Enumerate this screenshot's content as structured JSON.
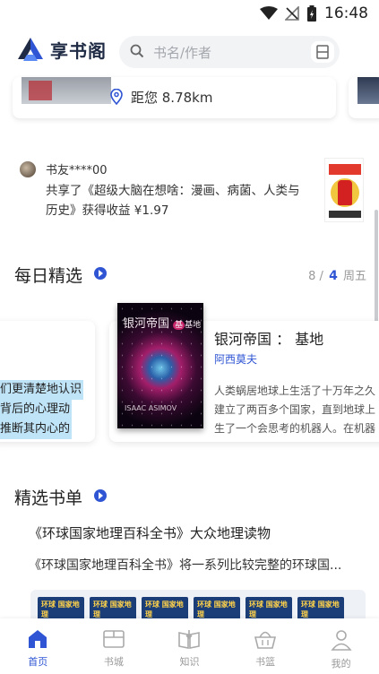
{
  "status_bar": {
    "time": "16:48"
  },
  "header": {
    "logo_text": "享书阁",
    "search_placeholder": "书名/作者"
  },
  "location_card": {
    "distance": "距您 8.78km"
  },
  "share": {
    "user": "书友****00",
    "text": "共享了《超级大脑在想啥：漫画、病菌、人类与历史》获得收益 ¥1.97"
  },
  "daily_picks": {
    "title": "每日精选",
    "pager": {
      "prefix": "8 /",
      "current": "4",
      "weekday": "周五"
    },
    "left_card_lines": [
      "们更清楚地认识",
      "背后的心理动",
      "推断其内心的"
    ],
    "book": {
      "cover_title": "银河帝国",
      "cover_sub": "基地",
      "cover_author": "ISAAC ASIMOV",
      "title": "银河帝国 ： 基地",
      "author": "阿西莫夫",
      "desc_lines": [
        "人类蜗居地球上生活了十万年之久",
        "建立了两百多个国家，直到地球上",
        "生了一个会思考的机器人。在机器"
      ]
    }
  },
  "booklist": {
    "title": "精选书单",
    "name": "《环球国家地理百科全书》大众地理读物",
    "desc": "《环球国家地理百科全书》将一系列比较完整的环球国...",
    "mag_labels": [
      "环球 国家地理",
      "环球 国家地理",
      "环球 国家地理",
      "环球 国家地理",
      "环球 国家地理",
      "环球 国家地理"
    ]
  },
  "bottom_nav": [
    {
      "label": "首页",
      "icon": "home-icon",
      "active": true
    },
    {
      "label": "书城",
      "icon": "bookstore-icon",
      "active": false
    },
    {
      "label": "知识",
      "icon": "knowledge-icon",
      "active": false
    },
    {
      "label": "书篮",
      "icon": "basket-icon",
      "active": false
    },
    {
      "label": "我的",
      "icon": "profile-icon",
      "active": false
    }
  ],
  "colors": {
    "accent": "#2f55d4",
    "text": "#222222",
    "muted": "#999999"
  }
}
